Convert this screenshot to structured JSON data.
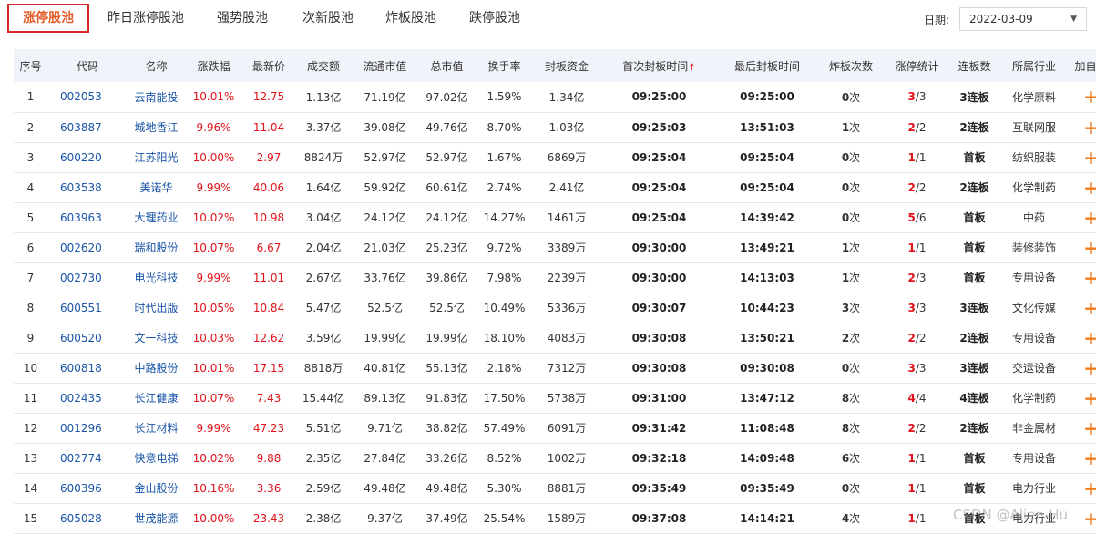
{
  "tabs": [
    "涨停股池",
    "昨日涨停股池",
    "强势股池",
    "次新股池",
    "炸板股池",
    "跌停股池"
  ],
  "date": {
    "label": "日期:",
    "value": "2022-03-09"
  },
  "headers": [
    "序号",
    "代码",
    "名称",
    "涨跌幅",
    "最新价",
    "成交额",
    "流通市值",
    "总市值",
    "换手率",
    "封板资金",
    "首次封板时间",
    "最后封板时间",
    "炸板次数",
    "涨停统计",
    "连板数",
    "所属行业",
    "加自选"
  ],
  "sort_indicator": "↑",
  "add_symbol": "+",
  "rows": [
    {
      "no": "1",
      "code": "002053",
      "name": "云南能投",
      "chg": "10.01%",
      "price": "12.75",
      "amount": "1.13亿",
      "float_cap": "71.19亿",
      "total_cap": "97.02亿",
      "turnover": "1.59%",
      "seal": "1.34亿",
      "first_time": "09:25:00",
      "last_time": "09:25:00",
      "break_count": "0",
      "stat_hit": "3",
      "stat_total": "/3",
      "streak": "3连板",
      "industry": "化学原料"
    },
    {
      "no": "2",
      "code": "603887",
      "name": "城地香江",
      "chg": "9.96%",
      "price": "11.04",
      "amount": "3.37亿",
      "float_cap": "39.08亿",
      "total_cap": "49.76亿",
      "turnover": "8.70%",
      "seal": "1.03亿",
      "first_time": "09:25:03",
      "last_time": "13:51:03",
      "break_count": "1",
      "stat_hit": "2",
      "stat_total": "/2",
      "streak": "2连板",
      "industry": "互联网服"
    },
    {
      "no": "3",
      "code": "600220",
      "name": "江苏阳光",
      "chg": "10.00%",
      "price": "2.97",
      "amount": "8824万",
      "float_cap": "52.97亿",
      "total_cap": "52.97亿",
      "turnover": "1.67%",
      "seal": "6869万",
      "first_time": "09:25:04",
      "last_time": "09:25:04",
      "break_count": "0",
      "stat_hit": "1",
      "stat_total": "/1",
      "streak": "首板",
      "industry": "纺织服装"
    },
    {
      "no": "4",
      "code": "603538",
      "name": "美诺华",
      "chg": "9.99%",
      "price": "40.06",
      "amount": "1.64亿",
      "float_cap": "59.92亿",
      "total_cap": "60.61亿",
      "turnover": "2.74%",
      "seal": "2.41亿",
      "first_time": "09:25:04",
      "last_time": "09:25:04",
      "break_count": "0",
      "stat_hit": "2",
      "stat_total": "/2",
      "streak": "2连板",
      "industry": "化学制药"
    },
    {
      "no": "5",
      "code": "603963",
      "name": "大理药业",
      "chg": "10.02%",
      "price": "10.98",
      "amount": "3.04亿",
      "float_cap": "24.12亿",
      "total_cap": "24.12亿",
      "turnover": "14.27%",
      "seal": "1461万",
      "first_time": "09:25:04",
      "last_time": "14:39:42",
      "break_count": "0",
      "stat_hit": "5",
      "stat_total": "/6",
      "streak": "首板",
      "industry": "中药"
    },
    {
      "no": "6",
      "code": "002620",
      "name": "瑞和股份",
      "chg": "10.07%",
      "price": "6.67",
      "amount": "2.04亿",
      "float_cap": "21.03亿",
      "total_cap": "25.23亿",
      "turnover": "9.72%",
      "seal": "3389万",
      "first_time": "09:30:00",
      "last_time": "13:49:21",
      "break_count": "1",
      "stat_hit": "1",
      "stat_total": "/1",
      "streak": "首板",
      "industry": "装修装饰"
    },
    {
      "no": "7",
      "code": "002730",
      "name": "电光科技",
      "chg": "9.99%",
      "price": "11.01",
      "amount": "2.67亿",
      "float_cap": "33.76亿",
      "total_cap": "39.86亿",
      "turnover": "7.98%",
      "seal": "2239万",
      "first_time": "09:30:00",
      "last_time": "14:13:03",
      "break_count": "1",
      "stat_hit": "2",
      "stat_total": "/3",
      "streak": "首板",
      "industry": "专用设备"
    },
    {
      "no": "8",
      "code": "600551",
      "name": "时代出版",
      "chg": "10.05%",
      "price": "10.84",
      "amount": "5.47亿",
      "float_cap": "52.5亿",
      "total_cap": "52.5亿",
      "turnover": "10.49%",
      "seal": "5336万",
      "first_time": "09:30:07",
      "last_time": "10:44:23",
      "break_count": "3",
      "stat_hit": "3",
      "stat_total": "/3",
      "streak": "3连板",
      "industry": "文化传媒"
    },
    {
      "no": "9",
      "code": "600520",
      "name": "文一科技",
      "chg": "10.03%",
      "price": "12.62",
      "amount": "3.59亿",
      "float_cap": "19.99亿",
      "total_cap": "19.99亿",
      "turnover": "18.10%",
      "seal": "4083万",
      "first_time": "09:30:08",
      "last_time": "13:50:21",
      "break_count": "2",
      "stat_hit": "2",
      "stat_total": "/2",
      "streak": "2连板",
      "industry": "专用设备"
    },
    {
      "no": "10",
      "code": "600818",
      "name": "中路股份",
      "chg": "10.01%",
      "price": "17.15",
      "amount": "8818万",
      "float_cap": "40.81亿",
      "total_cap": "55.13亿",
      "turnover": "2.18%",
      "seal": "7312万",
      "first_time": "09:30:08",
      "last_time": "09:30:08",
      "break_count": "0",
      "stat_hit": "3",
      "stat_total": "/3",
      "streak": "3连板",
      "industry": "交运设备"
    },
    {
      "no": "11",
      "code": "002435",
      "name": "长江健康",
      "chg": "10.07%",
      "price": "7.43",
      "amount": "15.44亿",
      "float_cap": "89.13亿",
      "total_cap": "91.83亿",
      "turnover": "17.50%",
      "seal": "5738万",
      "first_time": "09:31:00",
      "last_time": "13:47:12",
      "break_count": "8",
      "stat_hit": "4",
      "stat_total": "/4",
      "streak": "4连板",
      "industry": "化学制药"
    },
    {
      "no": "12",
      "code": "001296",
      "name": "长江材料",
      "chg": "9.99%",
      "price": "47.23",
      "amount": "5.51亿",
      "float_cap": "9.71亿",
      "total_cap": "38.82亿",
      "turnover": "57.49%",
      "seal": "6091万",
      "first_time": "09:31:42",
      "last_time": "11:08:48",
      "break_count": "8",
      "stat_hit": "2",
      "stat_total": "/2",
      "streak": "2连板",
      "industry": "非金属材"
    },
    {
      "no": "13",
      "code": "002774",
      "name": "快意电梯",
      "chg": "10.02%",
      "price": "9.88",
      "amount": "2.35亿",
      "float_cap": "27.84亿",
      "total_cap": "33.26亿",
      "turnover": "8.52%",
      "seal": "1002万",
      "first_time": "09:32:18",
      "last_time": "14:09:48",
      "break_count": "6",
      "stat_hit": "1",
      "stat_total": "/1",
      "streak": "首板",
      "industry": "专用设备"
    },
    {
      "no": "14",
      "code": "600396",
      "name": "金山股份",
      "chg": "10.16%",
      "price": "3.36",
      "amount": "2.59亿",
      "float_cap": "49.48亿",
      "total_cap": "49.48亿",
      "turnover": "5.30%",
      "seal": "8881万",
      "first_time": "09:35:49",
      "last_time": "09:35:49",
      "break_count": "0",
      "stat_hit": "1",
      "stat_total": "/1",
      "streak": "首板",
      "industry": "电力行业"
    },
    {
      "no": "15",
      "code": "605028",
      "name": "世茂能源",
      "chg": "10.00%",
      "price": "23.43",
      "amount": "2.38亿",
      "float_cap": "9.37亿",
      "total_cap": "37.49亿",
      "turnover": "25.54%",
      "seal": "1589万",
      "first_time": "09:37:08",
      "last_time": "14:14:21",
      "break_count": "4",
      "stat_hit": "1",
      "stat_total": "/1",
      "streak": "首板",
      "industry": "电力行业"
    }
  ],
  "break_unit": "次",
  "watermark": "CSDN @Alien-Hu"
}
